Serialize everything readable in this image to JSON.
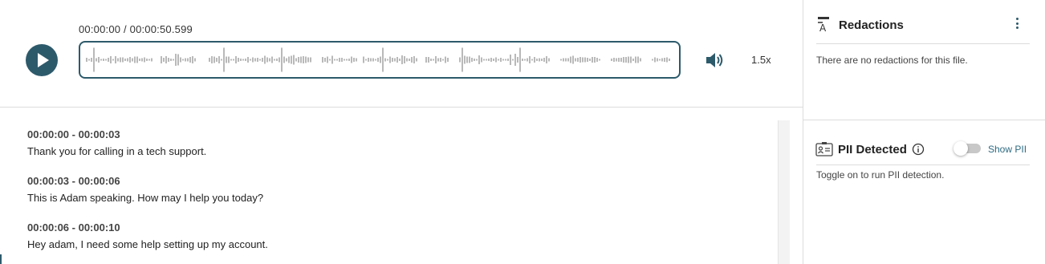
{
  "player": {
    "time_readout": "00:00:00 / 00:00:50.599",
    "speed": "1.5x",
    "icons": {
      "play": "play-icon",
      "volume": "volume-icon"
    }
  },
  "transcript": {
    "segments": [
      {
        "time": "00:00:00 - 00:00:03",
        "text": "Thank you for calling in a tech support."
      },
      {
        "time": "00:00:03 - 00:00:06",
        "text": "This is Adam speaking. How may I help you today?"
      },
      {
        "time": "00:00:06 - 00:00:10",
        "text": "Hey adam, I need some help setting up my account."
      }
    ]
  },
  "redactions": {
    "title": "Redactions",
    "empty_message": "There are no redactions for this file.",
    "icon": "redaction-icon"
  },
  "pii": {
    "title": "PII Detected",
    "toggle_label": "Show PII",
    "toggle_on": false,
    "help_text": "Toggle on to run PII detection.",
    "icon": "id-card-icon"
  },
  "colors": {
    "accent": "#2d5a6b",
    "link": "#2d6a80",
    "waveform": "#8a8a8a",
    "divider": "#dcdcdc"
  }
}
